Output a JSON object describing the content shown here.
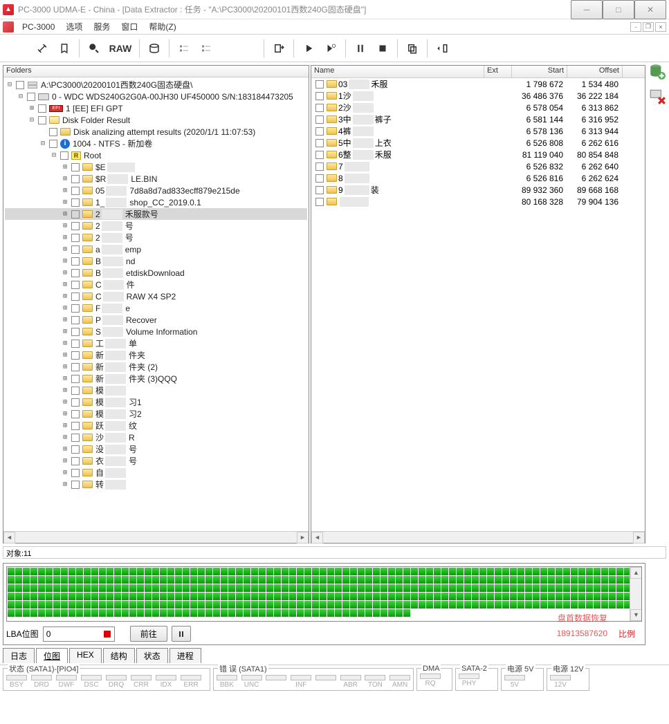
{
  "title": "PC-3000 UDMA-E - China - [Data Extractor : 任务 - \"A:\\PC3000\\20200101西数240G固态硬盘\"]",
  "menu": {
    "app": "PC-3000",
    "opts": "选项",
    "svc": "服务",
    "win": "窗口",
    "help": "帮助(Z)"
  },
  "toolbar": {
    "raw": "RAW"
  },
  "leftHeader": "Folders",
  "tree": [
    {
      "ind": 0,
      "exp": "-",
      "cb": false,
      "icon": "drives",
      "label": "A:\\PC3000\\20200101西数240G固态硬盘\\"
    },
    {
      "ind": 1,
      "exp": "-",
      "cb": true,
      "icon": "hdd",
      "label": "0 - WDC WDS240G2G0A-00JH30 UF450000 S/N:183184473205"
    },
    {
      "ind": 2,
      "exp": "+",
      "cb": true,
      "icon": "efi",
      "label": "1 [EE] EFI GPT"
    },
    {
      "ind": 2,
      "exp": "-",
      "cb": false,
      "icon": "foldero",
      "label": "Disk Folder Result"
    },
    {
      "ind": 3,
      "exp": "",
      "cb": true,
      "icon": "folder",
      "label": "Disk analizing attempt results (2020/1/1 11:07:53)"
    },
    {
      "ind": 3,
      "exp": "-",
      "cb": true,
      "icon": "info",
      "label": "1004 - NTFS - 新加卷"
    },
    {
      "ind": 4,
      "exp": "-",
      "cb": true,
      "icon": "root",
      "label": "Root"
    },
    {
      "ind": 5,
      "exp": "+",
      "cb": true,
      "icon": "folder",
      "label": "$E",
      "censor": 40
    },
    {
      "ind": 5,
      "exp": "+",
      "cb": true,
      "icon": "folder",
      "label": "$R",
      "censor": 30,
      "suffix": "LE.BIN"
    },
    {
      "ind": 5,
      "exp": "+",
      "cb": true,
      "icon": "folder",
      "label": "05",
      "censor": 30,
      "suffix": "7d8a8d7ad833ecff879e215de"
    },
    {
      "ind": 5,
      "exp": "+",
      "cb": true,
      "icon": "folder",
      "label": "1_",
      "censor": 30,
      "suffix": "shop_CC_2019.0.1"
    },
    {
      "ind": 5,
      "exp": "+",
      "cb": true,
      "icon": "folder",
      "label": "2",
      "censor": 30,
      "suffix": "禾服款号",
      "sel": true
    },
    {
      "ind": 5,
      "exp": "+",
      "cb": true,
      "icon": "folder",
      "label": "2",
      "censor": 30,
      "suffix": "号"
    },
    {
      "ind": 5,
      "exp": "+",
      "cb": true,
      "icon": "folder",
      "label": "2",
      "censor": 30,
      "suffix": "号"
    },
    {
      "ind": 5,
      "exp": "+",
      "cb": true,
      "icon": "folder",
      "label": "a",
      "censor": 30,
      "suffix": "emp"
    },
    {
      "ind": 5,
      "exp": "+",
      "cb": true,
      "icon": "folder",
      "label": "B",
      "censor": 30,
      "suffix": "nd"
    },
    {
      "ind": 5,
      "exp": "+",
      "cb": true,
      "icon": "folder",
      "label": "B",
      "censor": 30,
      "suffix": "etdiskDownload"
    },
    {
      "ind": 5,
      "exp": "+",
      "cb": true,
      "icon": "folder",
      "label": "C",
      "censor": 30,
      "suffix": "件"
    },
    {
      "ind": 5,
      "exp": "+",
      "cb": true,
      "icon": "folder",
      "label": "C",
      "censor": 30,
      "suffix": "RAW X4 SP2"
    },
    {
      "ind": 5,
      "exp": "+",
      "cb": true,
      "icon": "folder",
      "label": "F",
      "censor": 30,
      "suffix": "e"
    },
    {
      "ind": 5,
      "exp": "+",
      "cb": true,
      "icon": "folder",
      "label": "P",
      "censor": 30,
      "suffix": "Recover"
    },
    {
      "ind": 5,
      "exp": "+",
      "cb": true,
      "icon": "folder",
      "label": "S",
      "censor": 30,
      "suffix": "Volume Information"
    },
    {
      "ind": 5,
      "exp": "+",
      "cb": true,
      "icon": "folder",
      "label": "工",
      "censor": 30,
      "suffix": "单"
    },
    {
      "ind": 5,
      "exp": "+",
      "cb": true,
      "icon": "folder",
      "label": "新",
      "censor": 30,
      "suffix": "件夹"
    },
    {
      "ind": 5,
      "exp": "+",
      "cb": true,
      "icon": "folder",
      "label": "新",
      "censor": 30,
      "suffix": "件夹 (2)"
    },
    {
      "ind": 5,
      "exp": "+",
      "cb": true,
      "icon": "folder",
      "label": "新",
      "censor": 30,
      "suffix": "件夹 (3)QQQ"
    },
    {
      "ind": 5,
      "exp": "+",
      "cb": true,
      "icon": "folder",
      "label": "模",
      "censor": 30
    },
    {
      "ind": 5,
      "exp": "+",
      "cb": true,
      "icon": "folder",
      "label": "模",
      "censor": 30,
      "suffix": "习1"
    },
    {
      "ind": 5,
      "exp": "+",
      "cb": true,
      "icon": "folder",
      "label": "模",
      "censor": 30,
      "suffix": "习2"
    },
    {
      "ind": 5,
      "exp": "+",
      "cb": true,
      "icon": "folder",
      "label": "跃",
      "censor": 30,
      "suffix": "纹"
    },
    {
      "ind": 5,
      "exp": "+",
      "cb": true,
      "icon": "folder",
      "label": "沙",
      "censor": 30,
      "suffix": "R"
    },
    {
      "ind": 5,
      "exp": "+",
      "cb": true,
      "icon": "folder",
      "label": "没",
      "censor": 30,
      "suffix": "号"
    },
    {
      "ind": 5,
      "exp": "+",
      "cb": true,
      "icon": "folder",
      "label": "衣",
      "censor": 30,
      "suffix": "号"
    },
    {
      "ind": 5,
      "exp": "+",
      "cb": true,
      "icon": "folder",
      "label": "自",
      "censor": 30
    },
    {
      "ind": 5,
      "exp": "+",
      "cb": true,
      "icon": "folder",
      "label": "转",
      "censor": 30
    }
  ],
  "listCols": {
    "name": "Name",
    "ext": "Ext",
    "start": "Start",
    "offset": "Offset"
  },
  "listRows": [
    {
      "name": "03",
      "censor": 30,
      "suffix": "禾服",
      "start": "1 798 672",
      "offset": "1 534 480"
    },
    {
      "name": "1沙",
      "censor": 30,
      "suffix": "",
      "start": "36 486 376",
      "offset": "36 222 184"
    },
    {
      "name": "2沙",
      "censor": 30,
      "suffix": "",
      "start": "6 578 054",
      "offset": "6 313 862"
    },
    {
      "name": "3中",
      "censor": 30,
      "suffix": "裤子",
      "start": "6 581 144",
      "offset": "6 316 952"
    },
    {
      "name": "4裤",
      "censor": 30,
      "suffix": "",
      "start": "6 578 136",
      "offset": "6 313 944"
    },
    {
      "name": "5中",
      "censor": 30,
      "suffix": "上衣",
      "start": "6 526 808",
      "offset": "6 262 616"
    },
    {
      "name": "6整",
      "censor": 30,
      "suffix": "禾服",
      "start": "81 119 040",
      "offset": "80 854 848"
    },
    {
      "name": "7",
      "censor": 36,
      "suffix": "",
      "start": "6 526 832",
      "offset": "6 262 640"
    },
    {
      "name": "8",
      "censor": 36,
      "suffix": "",
      "start": "6 526 816",
      "offset": "6 262 624"
    },
    {
      "name": "9",
      "censor": 36,
      "suffix": "装",
      "start": "89 932 360",
      "offset": "89 668 168"
    },
    {
      "name": "",
      "censor": 42,
      "suffix": "",
      "start": "80 168 328",
      "offset": "79 904 136"
    }
  ],
  "status": {
    "objects": "对象:11"
  },
  "lba": {
    "label": "LBA位图",
    "value": "0",
    "go": "前往",
    "ratio": "比例"
  },
  "watermark": {
    "line1": "盘首数据恢复",
    "line2": "18913587620"
  },
  "tabs": [
    "日志",
    "位图",
    "HEX",
    "结构",
    "状态",
    "进程"
  ],
  "statusGroups": [
    {
      "title": "状态 (SATA1)-[PIO4]",
      "leds": [
        "BSY",
        "DRD",
        "DWF",
        "DSC",
        "DRQ",
        "CRR",
        "IDX",
        "ERR"
      ]
    },
    {
      "title": "错 误 (SATA1)",
      "leds": [
        "BBK",
        "UNC",
        "",
        "INF",
        "",
        "ABR",
        "TON",
        "AMN"
      ]
    },
    {
      "title": "DMA",
      "leds": [
        "RQ"
      ]
    },
    {
      "title": "SATA-2",
      "leds": [
        "PHY"
      ]
    },
    {
      "title": "电源 5V",
      "leds": [
        "5V"
      ]
    },
    {
      "title": "电源 12V",
      "leds": [
        "12V"
      ]
    }
  ]
}
